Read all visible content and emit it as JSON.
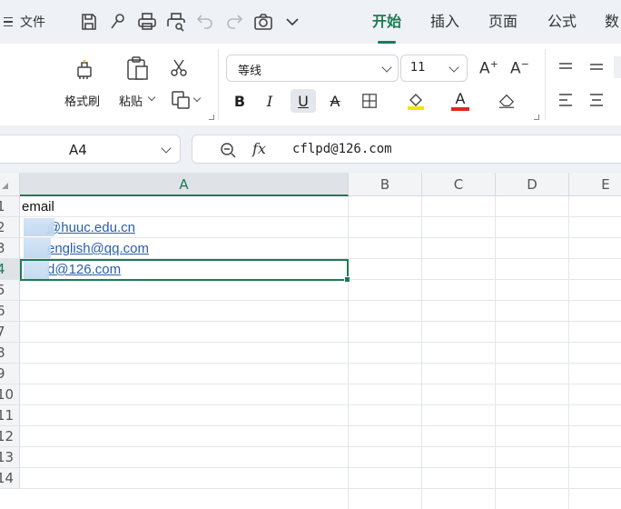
{
  "app": {
    "file_menu_label": "文件",
    "tabs": [
      {
        "label": "开始",
        "active": true
      },
      {
        "label": "插入",
        "active": false
      },
      {
        "label": "页面",
        "active": false
      },
      {
        "label": "公式",
        "active": false
      },
      {
        "label": "数",
        "active": false
      }
    ],
    "quick_access_icons": [
      "save-icon",
      "brush-icon",
      "print-icon",
      "print-preview-icon",
      "undo-icon",
      "redo-icon",
      "camera-icon",
      "chevron-down-icon"
    ]
  },
  "ribbon": {
    "format_painter_label": "格式刷",
    "paste_label": "粘贴",
    "font_name": "等线",
    "font_size": "11",
    "accent_color": "#1e7a55",
    "highlight_color": "#f5e400",
    "font_color": "#e0281c"
  },
  "formula_bar": {
    "name_box": "A4",
    "formula": "cflpd@126.com"
  },
  "sheet": {
    "columns": [
      "A",
      "B",
      "C",
      "D",
      "E"
    ],
    "selected_column": "A",
    "rows": [
      "1",
      "2",
      "3",
      "4",
      "5",
      "6",
      "7",
      "8",
      "9",
      "10",
      "11",
      "12",
      "13",
      "14"
    ],
    "selected_row": "4",
    "cells": {
      "A1": "email",
      "A2": "@huuc.edu.cn",
      "A3": "english@qq.com",
      "A4": "d@126.com"
    }
  }
}
